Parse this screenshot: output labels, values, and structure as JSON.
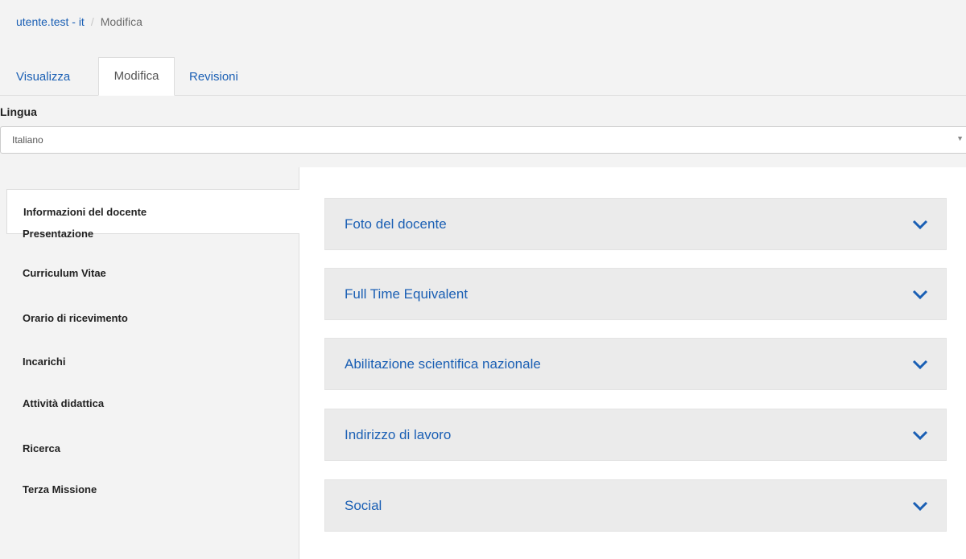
{
  "breadcrumb": {
    "link": "utente.test - it",
    "separator": "/",
    "current": "Modifica"
  },
  "tabs": [
    {
      "label": "Visualizza",
      "active": false
    },
    {
      "label": "Modifica",
      "active": true
    },
    {
      "label": "Revisioni",
      "active": false
    }
  ],
  "language": {
    "label": "Lingua",
    "selected": "Italiano"
  },
  "sidebar": {
    "items": [
      {
        "label": "Informazioni del docente",
        "active": true
      },
      {
        "label": "Presentazione",
        "active": false
      },
      {
        "label": "Curriculum Vitae",
        "active": false
      },
      {
        "label": "Orario di ricevimento",
        "active": false
      },
      {
        "label": "Incarichi",
        "active": false
      },
      {
        "label": "Attività didattica",
        "active": false
      },
      {
        "label": "Ricerca",
        "active": false
      },
      {
        "label": "Terza Missione",
        "active": false
      }
    ]
  },
  "panels": [
    {
      "title": "Foto del docente",
      "icon": "chevron-down-icon"
    },
    {
      "title": "Full Time Equivalent",
      "icon": "chevron-down-icon"
    },
    {
      "title": "Abilitazione scientifica nazionale",
      "icon": "chevron-down-icon"
    },
    {
      "title": "Indirizzo di lavoro",
      "icon": "chevron-down-icon"
    },
    {
      "title": "Social",
      "icon": "chevron-down-icon"
    }
  ],
  "colors": {
    "link": "#1a5fb4",
    "panel_bg": "#ebebeb",
    "page_bg": "#f3f3f3"
  }
}
